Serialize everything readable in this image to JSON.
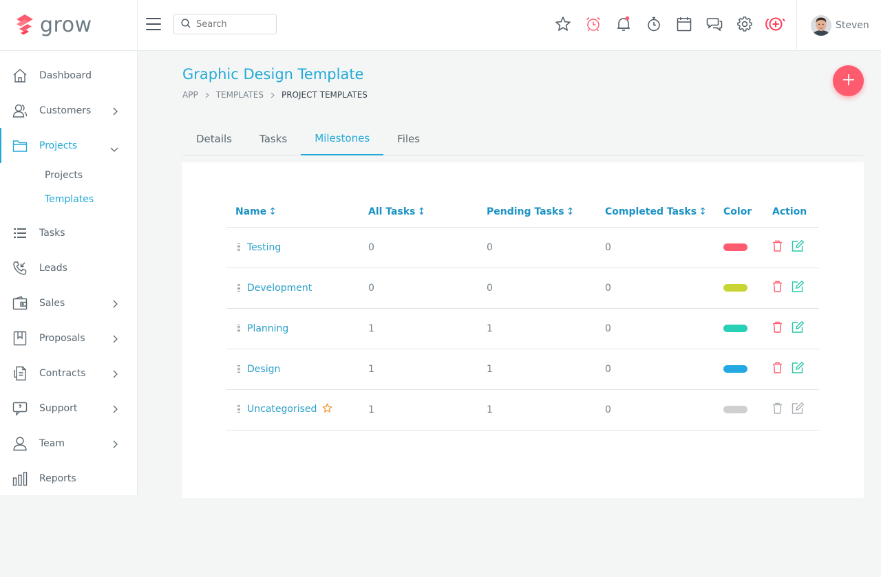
{
  "brand": {
    "name": "grow"
  },
  "nav": {
    "items": [
      {
        "label": "Dashboard",
        "icon": "home-icon"
      },
      {
        "label": "Customers",
        "icon": "customers-icon",
        "has_submenu": true
      },
      {
        "label": "Projects",
        "icon": "folder-icon",
        "has_submenu": true,
        "expanded": true
      },
      {
        "label": "Tasks",
        "icon": "list-icon"
      },
      {
        "label": "Leads",
        "icon": "phone-icon"
      },
      {
        "label": "Sales",
        "icon": "wallet-icon",
        "has_submenu": true
      },
      {
        "label": "Proposals",
        "icon": "bookmark-icon",
        "has_submenu": true
      },
      {
        "label": "Contracts",
        "icon": "contract-icon",
        "has_submenu": true
      },
      {
        "label": "Support",
        "icon": "chat-icon",
        "has_submenu": true
      },
      {
        "label": "Team",
        "icon": "user-icon",
        "has_submenu": true
      },
      {
        "label": "Reports",
        "icon": "bar-chart-icon"
      }
    ],
    "projects_sub": [
      {
        "label": "Projects"
      },
      {
        "label": "Templates",
        "active": true
      }
    ]
  },
  "topbar": {
    "search_placeholder": "Search",
    "icons": [
      "star-icon",
      "alarm-icon",
      "bell-icon",
      "stopwatch-icon",
      "calendar-icon",
      "chat-bubbles-icon",
      "gear-icon",
      "add-circle-icon"
    ],
    "user_name": "Steven"
  },
  "page": {
    "title": "Graphic Design Template",
    "breadcrumb": [
      "APP",
      "TEMPLATES",
      "PROJECT TEMPLATES"
    ]
  },
  "tabs": [
    {
      "label": "Details"
    },
    {
      "label": "Tasks"
    },
    {
      "label": "Milestones",
      "active": true
    },
    {
      "label": "Files"
    }
  ],
  "table": {
    "columns": [
      "Name",
      "All Tasks",
      "Pending Tasks",
      "Completed Tasks",
      "Color",
      "Action"
    ],
    "sort_glyph": "↕",
    "rows": [
      {
        "name": "Testing",
        "all": "0",
        "pending": "0",
        "completed": "0",
        "color": "#ff5b6e",
        "editable": true
      },
      {
        "name": "Development",
        "all": "0",
        "pending": "0",
        "completed": "0",
        "color": "#c8d633",
        "editable": true
      },
      {
        "name": "Planning",
        "all": "1",
        "pending": "1",
        "completed": "0",
        "color": "#28d1b5",
        "editable": true
      },
      {
        "name": "Design",
        "all": "1",
        "pending": "1",
        "completed": "0",
        "color": "#22a9e2",
        "editable": true
      },
      {
        "name": "Uncategorised",
        "all": "1",
        "pending": "1",
        "completed": "0",
        "color": "#cfcfcf",
        "editable": false,
        "starred": true
      }
    ]
  },
  "colors": {
    "accent": "#22a9d8",
    "danger": "#ff5b6e",
    "edit": "#28c8a8",
    "disabled": "#a9b0b5",
    "star": "#f0932b"
  }
}
